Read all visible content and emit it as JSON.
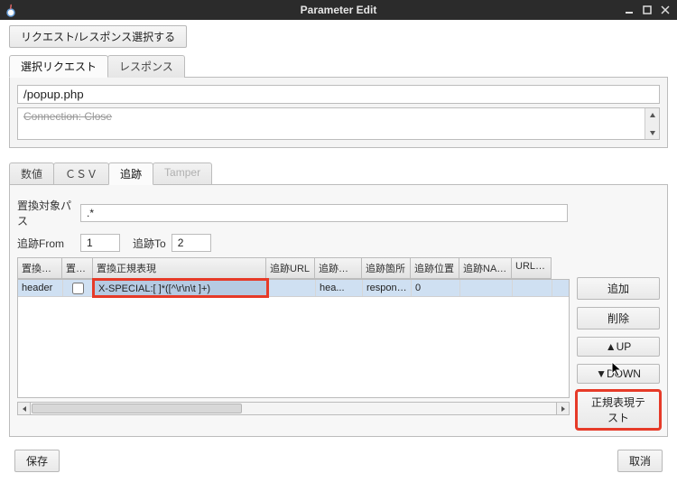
{
  "window": {
    "title": "Parameter Edit"
  },
  "top_button": "リクエスト/レスポンス選択する",
  "upper_tabs": [
    {
      "label": "選択リクエスト",
      "active": true
    },
    {
      "label": "レスポンス",
      "active": false
    }
  ],
  "request_path": "/popup.php",
  "request_preview_line1": "Connection: Close",
  "request_preview_line2": "",
  "lower_tabs": [
    {
      "label": "数値",
      "active": false
    },
    {
      "label": "ＣＳＶ",
      "active": false
    },
    {
      "label": "追跡",
      "active": true
    },
    {
      "label": "Tamper",
      "disabled": true
    }
  ],
  "replace_path_label": "置換対象パス",
  "replace_path_value": ".*",
  "track_from_label": "追跡From",
  "track_from_value": "1",
  "track_to_label": "追跡To",
  "track_to_value": "2",
  "columns": {
    "c0": "置換箇所",
    "c1": "置換し",
    "c2": "置換正規表現",
    "c3": "追跡URL",
    "c4": "追跡正規...",
    "c5": "追跡箇所",
    "c6": "追跡位置",
    "c7": "追跡NAM...",
    "c8": "URLenc"
  },
  "rows": [
    {
      "c0": "header",
      "c1_checked": false,
      "c2": "X-SPECIAL:[   ]*([^\\r\\n\\t ]+)",
      "c3": "",
      "c4": "hea...",
      "c5": "response...",
      "c6": "0",
      "c7": "",
      "c8": ""
    }
  ],
  "side_buttons": {
    "add": "追加",
    "delete": "削除",
    "up": "▲UP",
    "down": "▼DOWN",
    "regex_test": "正規表現テスト"
  },
  "footer": {
    "save": "保存",
    "cancel": "取消"
  }
}
